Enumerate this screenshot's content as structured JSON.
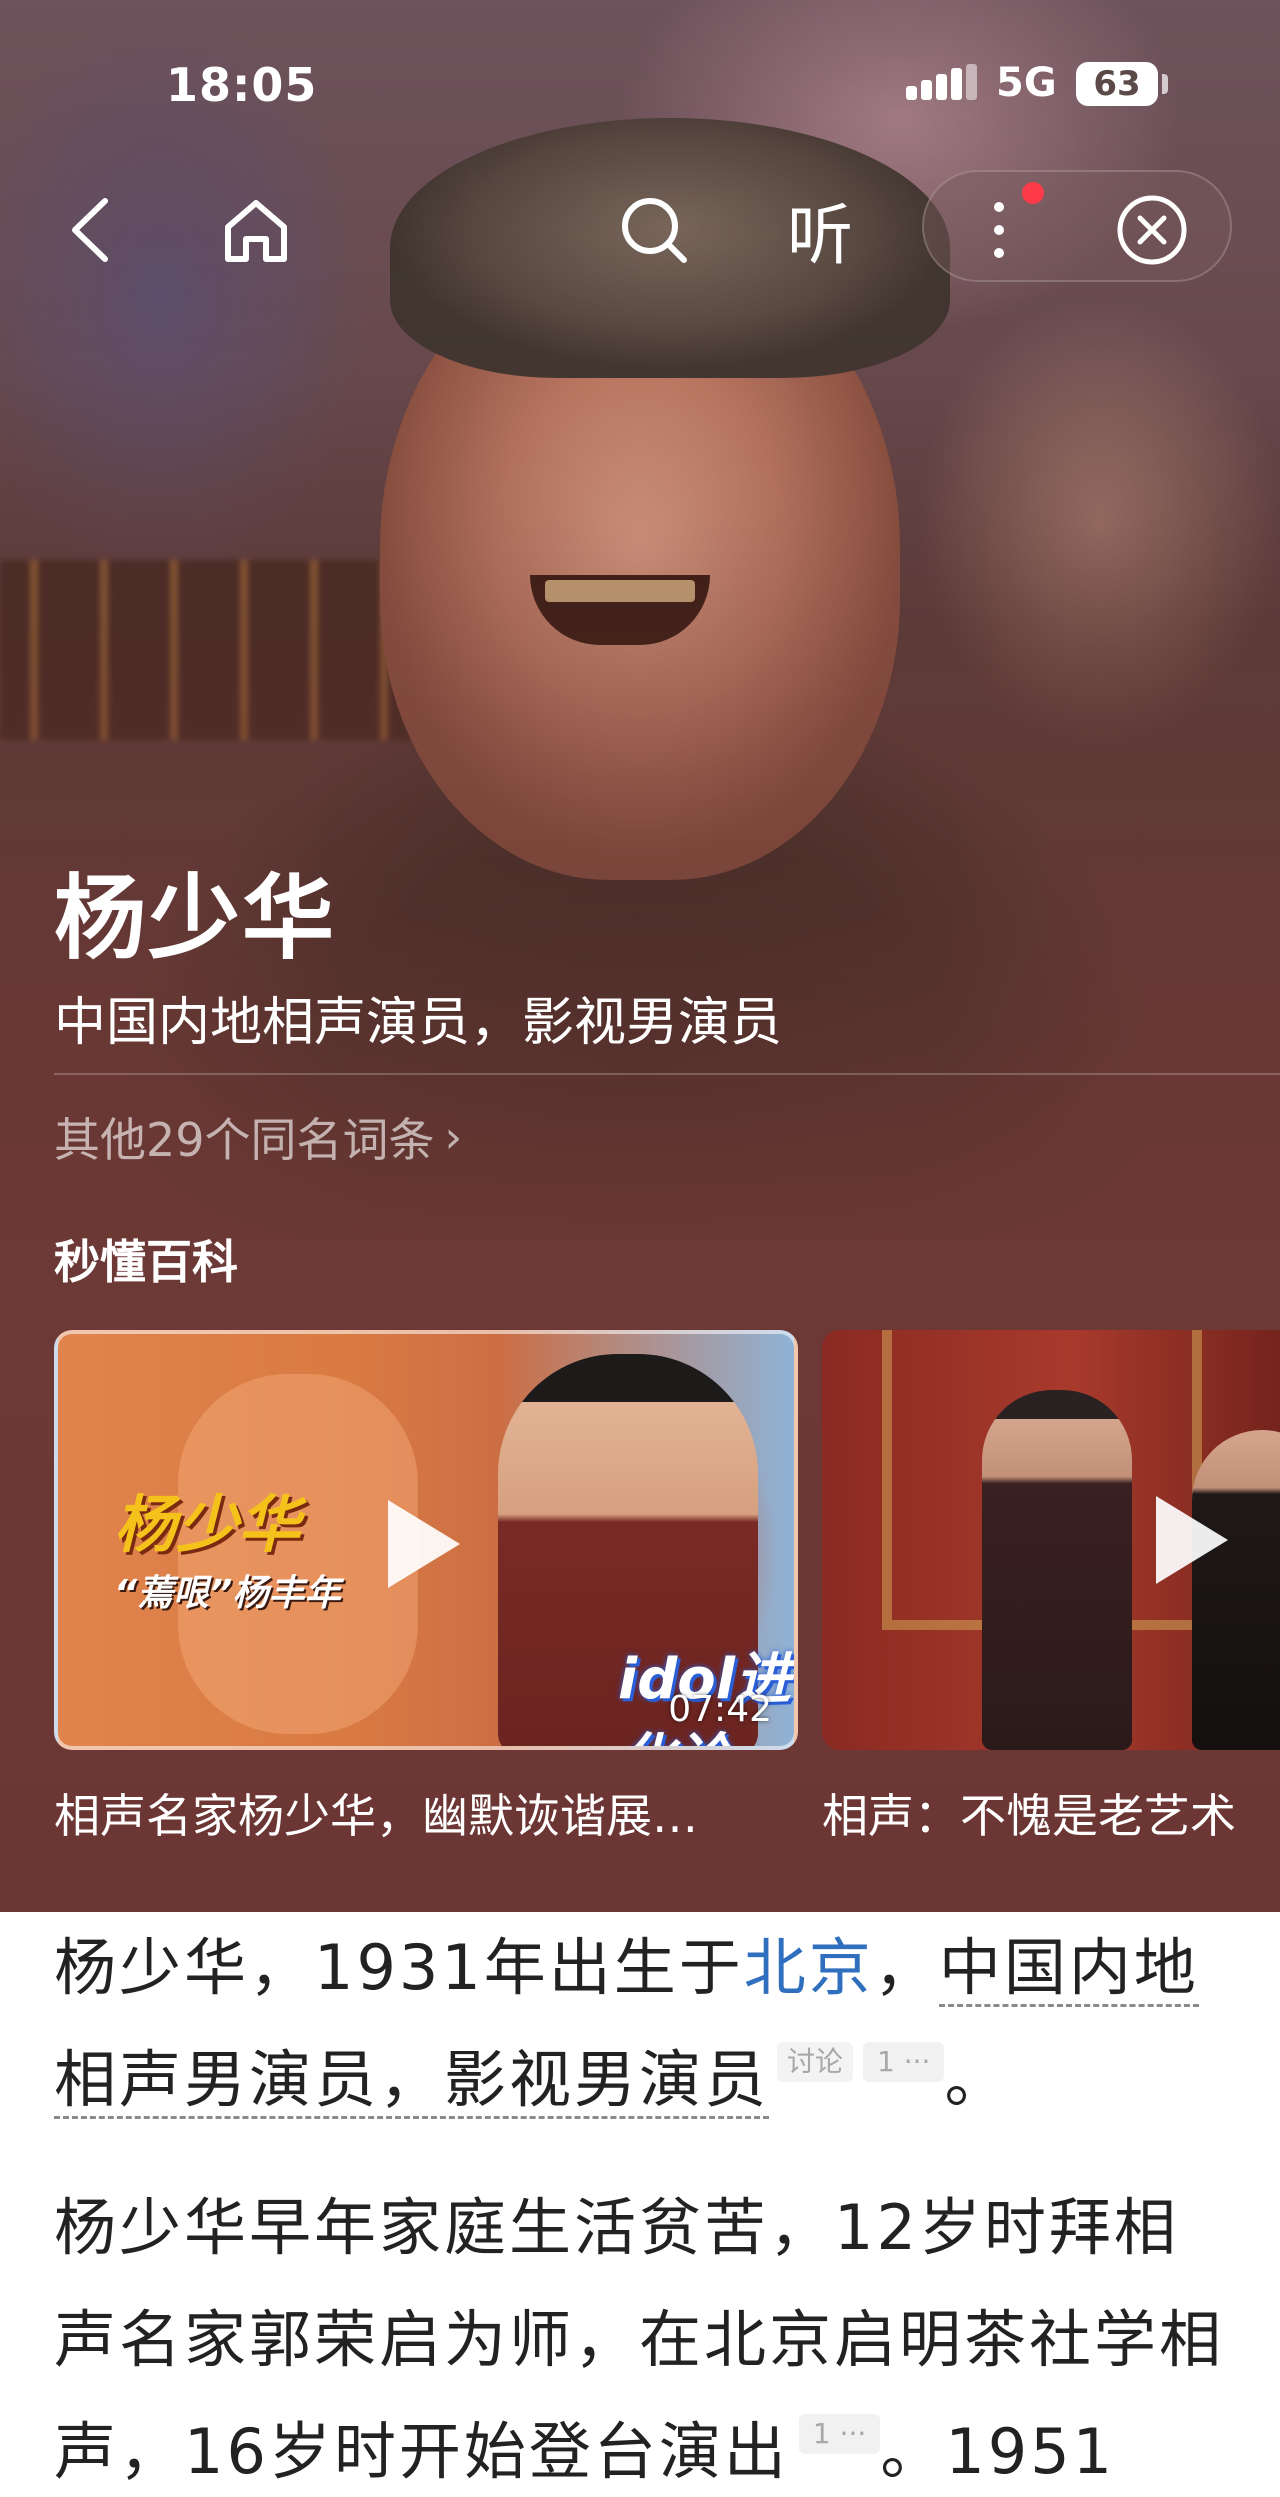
{
  "status_bar": {
    "time": "18:05",
    "network": "5G",
    "battery": "63"
  },
  "nav": {
    "back_icon": "chevron-left-icon",
    "home_icon": "home-icon",
    "search_icon": "search-icon",
    "listen_label": "听",
    "more_icon": "more-vertical-icon",
    "close_icon": "close-circle-icon",
    "notification_color": "#ff3b4a"
  },
  "entry": {
    "title": "杨少华",
    "subtitle": "中国内地相声演员，影视男演员",
    "other_entries": "其他29个同名词条",
    "other_chevron": "›"
  },
  "section": {
    "title": "秒懂百科"
  },
  "videos": [
    {
      "title": "相声名家杨少华，幽默诙谐展…",
      "overlay_name": "杨少华",
      "overlay_sub": "“蔫哏”杨丰年",
      "overlay_logo": "idol进化论",
      "duration": "07:42"
    },
    {
      "title": "相声：不愧是老艺术"
    }
  ],
  "article": {
    "p1_a": "杨少华，1931年出生于",
    "p1_link": "北京",
    "p1_b": "，",
    "p1_underlined": "中国内地相声男演员，影视男演员",
    "p1_tag": "讨论",
    "p1_cite": "1 ···",
    "p1_end": "。",
    "p2_a": "杨少华早年家庭生活贫苦，12岁时拜相声名家郭荣启为师，在北京启明茶社学相声，16岁时开始登台演出",
    "p2_cite": "1 ···",
    "p2_end": "。1951"
  },
  "colors": {
    "hero_bg": "#6b3634",
    "link": "#2f6fbe",
    "article_bg": "#ffffff"
  }
}
